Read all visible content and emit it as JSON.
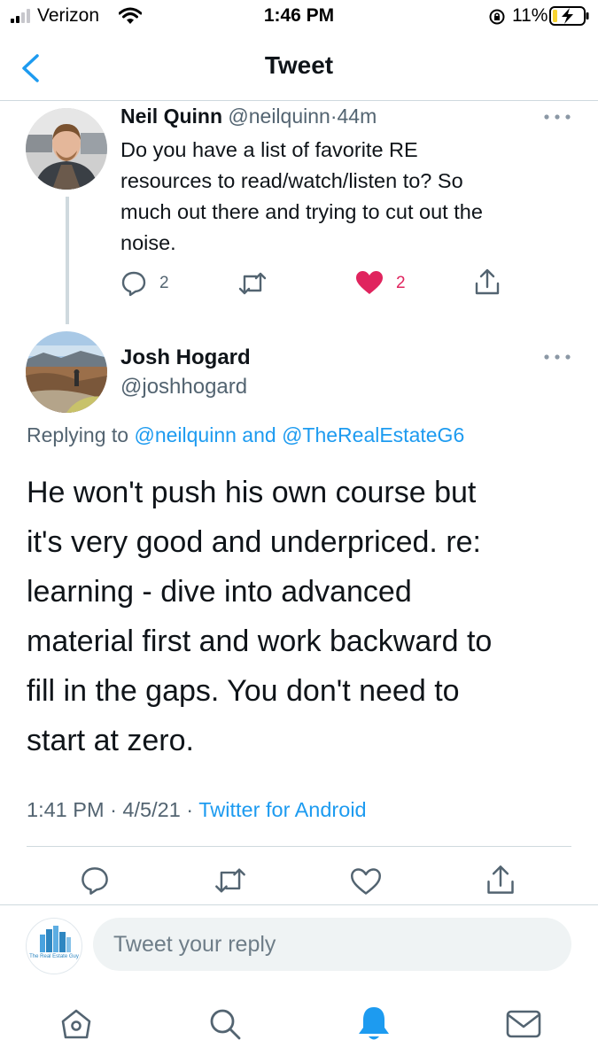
{
  "status_bar": {
    "carrier": "Verizon",
    "time": "1:46 PM",
    "battery": "11%"
  },
  "header": {
    "title": "Tweet"
  },
  "parent_tweet": {
    "display_name": "Neil Quinn",
    "handle": "@neilquinn",
    "separator": "·",
    "age": "44m",
    "text_lines": [
      "Do you have a list of favorite RE",
      "resources to read/watch/listen to? So",
      "much out there and trying to cut out the",
      "noise."
    ],
    "reply_count": "2",
    "like_count": "2"
  },
  "main_tweet": {
    "display_name": "Josh Hogard",
    "handle": "@joshhogard",
    "replying_prefix": "Replying to",
    "replying_user1": "@neilquinn",
    "replying_and": "and",
    "replying_user2": "@TheRealEstateG6",
    "text_lines": [
      "He won't push his own course but",
      "it's very good and underpriced. re:",
      "learning - dive into advanced",
      "material first and work backward to",
      "fill in the gaps. You don't need to",
      "start at zero."
    ],
    "time": "1:41 PM",
    "date": "4/5/21",
    "separator": "·",
    "source": "Twitter for Android"
  },
  "reply_box": {
    "placeholder": "Tweet your reply",
    "avatar_caption": "The Real Estate Guy"
  },
  "colors": {
    "accent": "#1d9bf0",
    "like": "#e0245e",
    "text": "#0f1419",
    "muted": "#536471"
  },
  "icons": [
    "wifi-icon",
    "battery-icon",
    "back-chevron-icon",
    "more-icon",
    "reply-icon",
    "retweet-icon",
    "like-icon",
    "share-icon",
    "home-icon",
    "search-icon",
    "notifications-icon",
    "messages-icon"
  ]
}
